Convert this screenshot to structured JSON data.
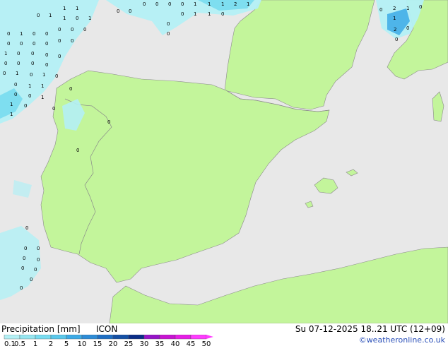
{
  "footer": {
    "title": "Precipitation [mm]",
    "model": "ICON",
    "validity": "Su 07-12-2025 18..21 UTC (12+09)",
    "credit": "©weatheronline.co.uk"
  },
  "legend": {
    "labels": [
      "0.1",
      "0.5",
      "1",
      "2",
      "5",
      "10",
      "15",
      "20",
      "25",
      "30",
      "35",
      "40",
      "45",
      "50"
    ],
    "colors": [
      "#b4f0f5",
      "#96e6f0",
      "#78dcf0",
      "#5ac8eb",
      "#3caae6",
      "#2d8cd7",
      "#1e6ec3",
      "#1450a5",
      "#0a2d87",
      "#9614c8",
      "#c814d2",
      "#e61ee6",
      "#ff3cff"
    ]
  },
  "map_colors": {
    "sea": "#e8e8e8",
    "land": "#c3f59b",
    "precip_light": "#b4f0f5",
    "precip_medium": "#78dcf0",
    "precip_heavy": "#3caae6",
    "border": "#7a7a7a"
  },
  "markers": [
    "0",
    "1",
    "2"
  ]
}
